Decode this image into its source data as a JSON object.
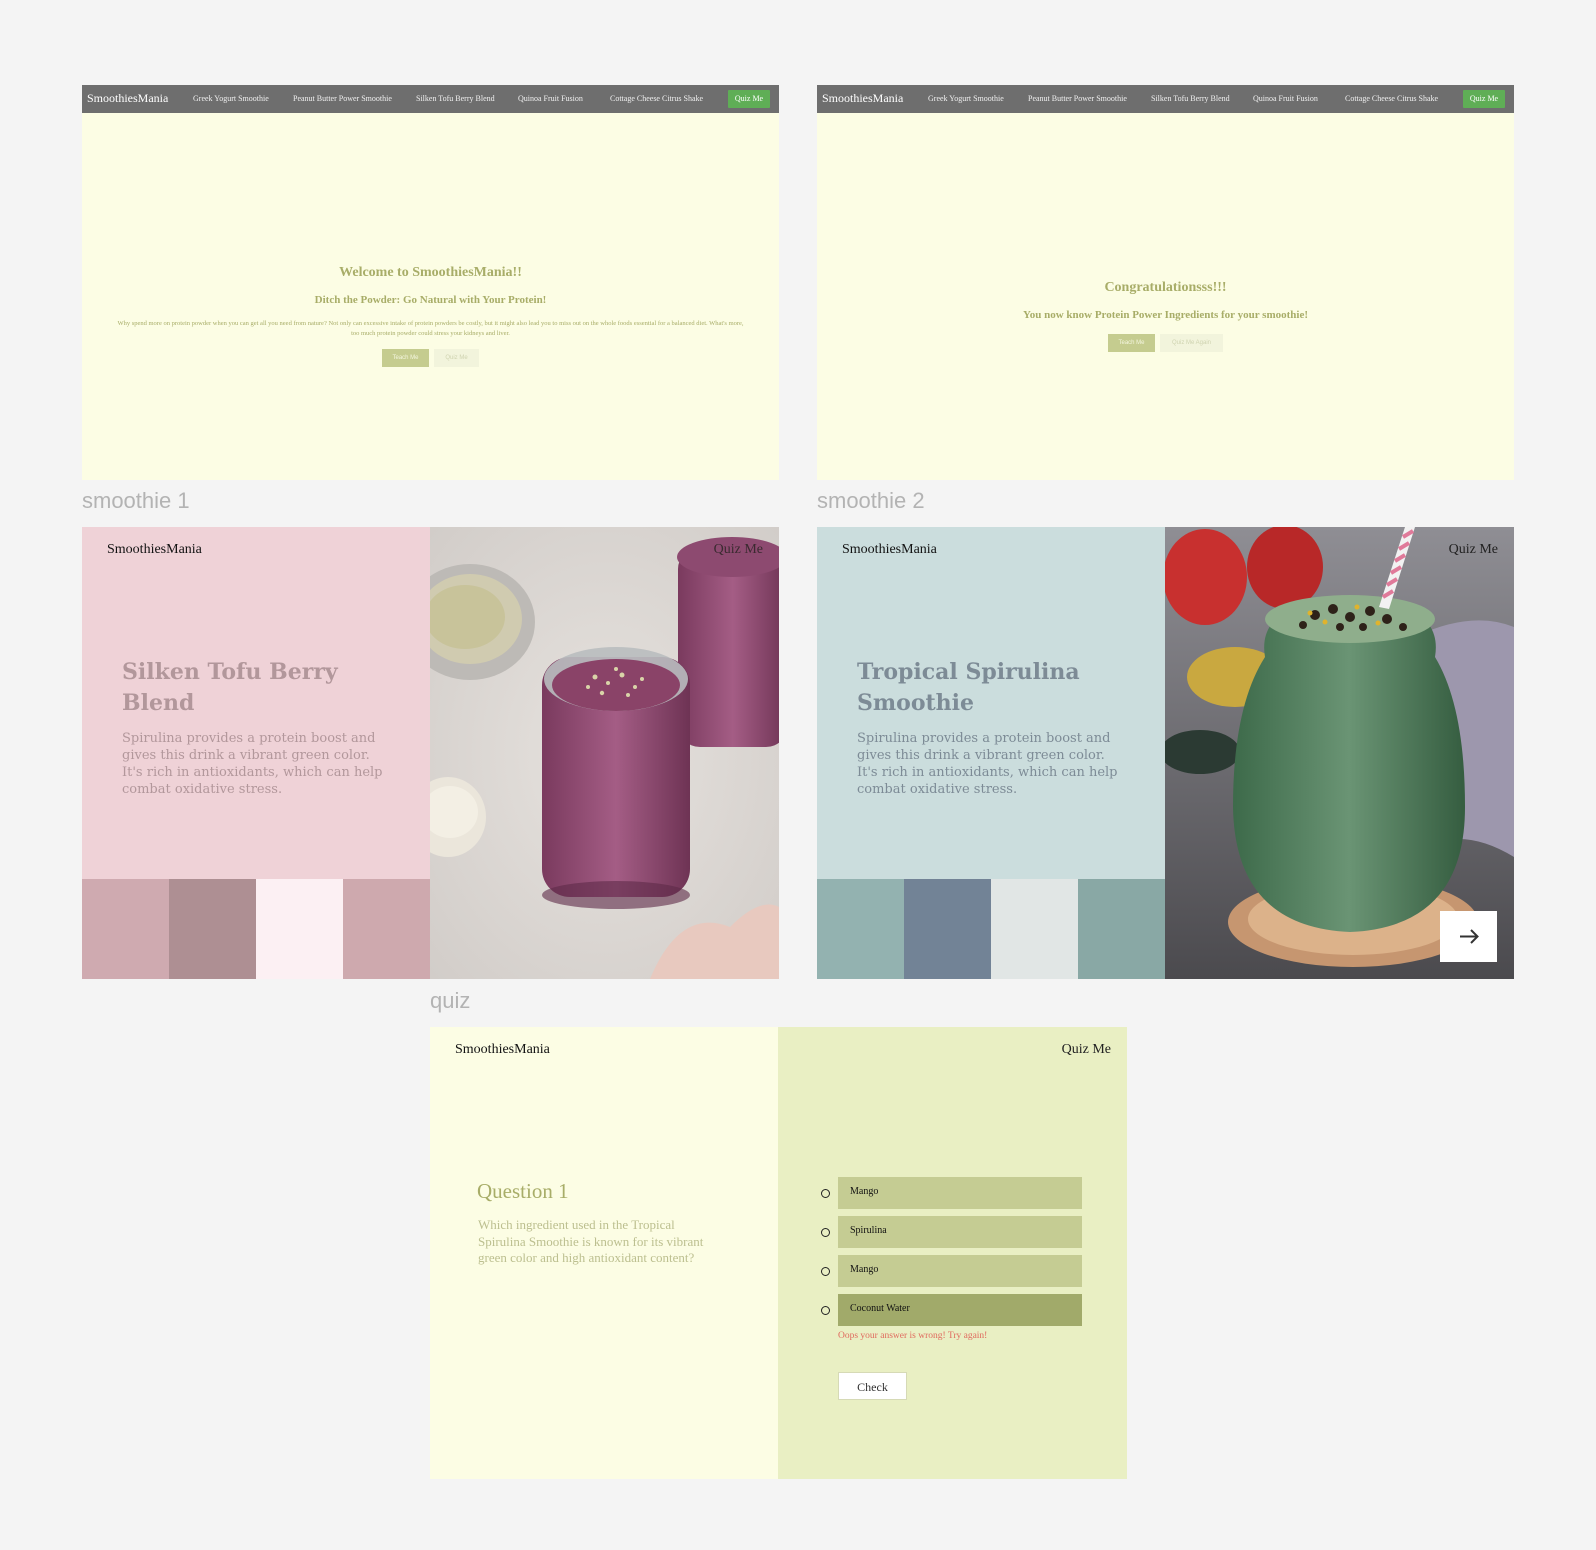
{
  "frames": {
    "smoothie1_label": "smoothie 1",
    "smoothie2_label": "smoothie 2",
    "quiz_label": "quiz"
  },
  "nav": {
    "brand": "SmoothiesMania",
    "links": [
      "Greek Yogurt Smoothie",
      "Peanut Butter Power Smoothie",
      "Silken Tofu Berry Blend",
      "Quinoa Fruit Fusion",
      "Cottage Cheese Citrus Shake"
    ],
    "quiz_button": "Quiz Me"
  },
  "landing_welcome": {
    "title": "Welcome to SmoothiesMania!!",
    "subtitle": "Ditch the Powder: Go Natural with Your Protein!",
    "paragraph": "Why spend more on protein powder when you can get all you need from nature? Not only can excessive intake of protein powders be costly, but it might also lead you to miss out on the whole foods essential for a balanced diet. What's more, too much protein powder could stress your kidneys and liver.",
    "teach_button": "Teach Me",
    "quiz_button": "Quiz Me"
  },
  "landing_congrats": {
    "title": "Congratulationsss!!!",
    "subtitle": "You now know Protein Power Ingredients for your smoothie!",
    "teach_button": "Teach Me",
    "quiz_again_button": "Quiz Me Again"
  },
  "smoothie1": {
    "brand": "SmoothiesMania",
    "quiz_link": "Quiz Me",
    "title": "Silken Tofu Berry Blend",
    "description": "Spirulina provides a protein boost and gives this drink a vibrant green color. It's rich in antioxidants, which can help combat oxidative stress.",
    "palette": [
      "#cfaab0",
      "#ae8f93",
      "#fcf0f3",
      "#cea9ae"
    ],
    "bg_color": "#efd2d7",
    "text_color": "#b2979b"
  },
  "smoothie2": {
    "brand": "SmoothiesMania",
    "quiz_link": "Quiz Me",
    "title": "Tropical Spirulina Smoothie",
    "description": "Spirulina provides a protein boost and gives this drink a vibrant green color. It's rich in antioxidants, which can help combat oxidative stress.",
    "palette": [
      "#93b2b0",
      "#728396",
      "#e1e6e5",
      "#89a8a5"
    ],
    "bg_color": "#cbdddd",
    "text_color": "#7d8b96",
    "next_icon": "arrow-right-icon"
  },
  "quiz": {
    "brand": "SmoothiesMania",
    "quiz_link": "Quiz Me",
    "question_title": "Question 1",
    "question_text": "Which ingredient used in the Tropical Spirulina Smoothie is known for its vibrant green color and high antioxidant content?",
    "options": [
      "Mango",
      "Spirulina",
      "Mango",
      "Coconut Water"
    ],
    "selected_option": "Coconut Water",
    "error_message": "Oops your answer is wrong! Try again!",
    "check_button": "Check"
  }
}
